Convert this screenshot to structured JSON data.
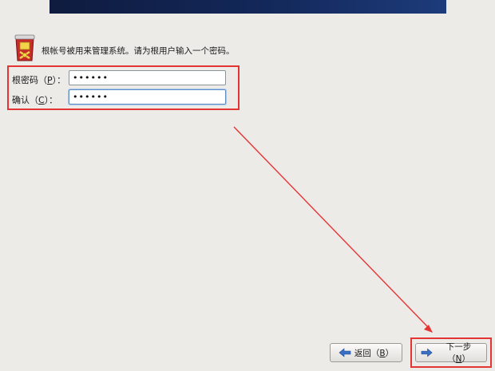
{
  "header": {
    "banner_color": "#13285a"
  },
  "info": {
    "icon": "root-user-icon",
    "text": "根帐号被用来管理系统。请为根用户输入一个密码。"
  },
  "form": {
    "password": {
      "label_prefix": "根密码（",
      "mnemonic": "P",
      "label_suffix": "）：",
      "value": "••••••"
    },
    "confirm": {
      "label_prefix": "确认（",
      "mnemonic": "C",
      "label_suffix": "）：",
      "value": "••••••"
    }
  },
  "buttons": {
    "back": {
      "icon": "arrow-left-icon",
      "label_prefix": "返回（",
      "mnemonic": "B",
      "label_suffix": "）"
    },
    "next": {
      "icon": "arrow-right-icon",
      "label_prefix": "下一步（",
      "mnemonic": "N",
      "label_suffix": "）"
    }
  },
  "colors": {
    "annotation_red": "#e53434",
    "background": "#edebe8",
    "focus_blue": "#5f8fc7",
    "arrow_blue": "#3b6fc4"
  }
}
